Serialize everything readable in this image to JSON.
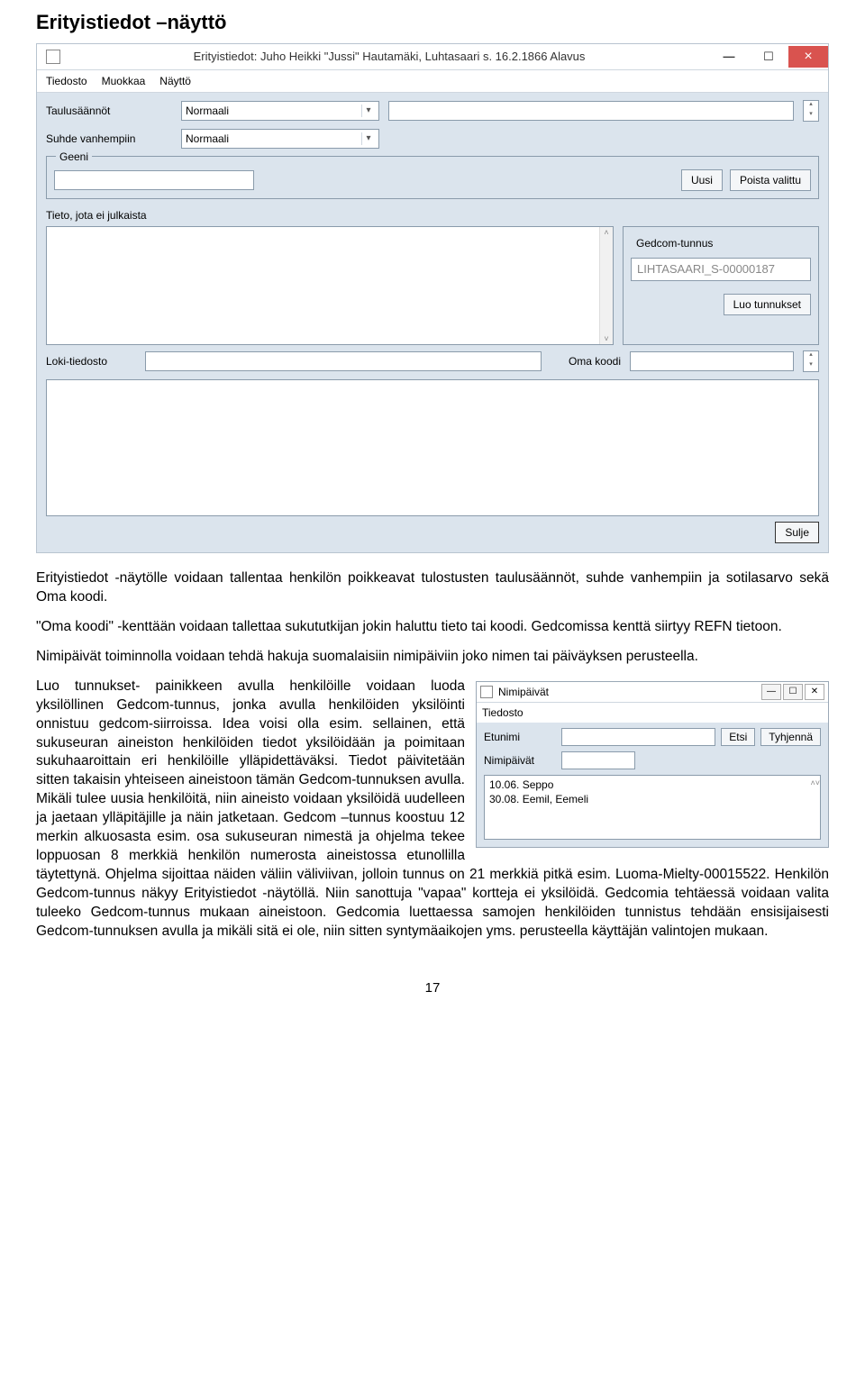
{
  "heading": "Erityistiedot –näyttö",
  "win1": {
    "title": "Erityistiedot: Juho Heikki \"Jussi\" Hautamäki, Luhtasaari  s. 16.2.1866 Alavus",
    "menu": {
      "file": "Tiedosto",
      "edit": "Muokkaa",
      "view": "Näyttö"
    },
    "row1_label": "Taulusäännöt",
    "row1_value": "Normaali",
    "row2_label": "Suhde vanhempiin",
    "row2_value": "Normaali",
    "geeni_legend": "Geeni",
    "btn_uusi": "Uusi",
    "btn_poista": "Poista valittu",
    "notpublic_label": "Tieto, jota ei julkaista",
    "gedcom_legend": "Gedcom-tunnus",
    "gedcom_value": "LIHTASAARI_S-00000187",
    "btn_luo": "Luo tunnukset",
    "loki_label": "Loki-tiedosto",
    "oma_label": "Oma koodi",
    "btn_sulje": "Sulje"
  },
  "para1": "Erityistiedot -näytölle voidaan tallentaa henkilön poikkeavat tulostusten taulusäännöt, suhde vanhempiin ja sotilasarvo sekä Oma koodi.",
  "para2": "\"Oma koodi\" -kenttään voidaan tallettaa sukututkijan jokin haluttu tieto tai koodi. Gedcomissa kenttä siirtyy REFN tietoon.",
  "para3": "Nimipäivät toiminnolla voidaan tehdä hakuja suomalaisiin nimipäiviin joko nimen tai päiväyksen perusteella.",
  "para4a": "Luo tunnukset- painikkeen avulla henkilöille voidaan luoda yksilöllinen Gedcom-tunnus, jonka avulla henkilöiden yksilöinti onnistuu gedcom-siirroissa. Idea voisi olla esim. sellainen, että sukuseuran aineiston henkilöiden tiedot yksilöidään ja poimitaan sukuhaaroittain eri henkilöille ylläpidettäväksi. Tie",
  "para4b": "dot päivitetään sitten takaisin yhteiseen aineistoon tämän Gedcom-tunnuksen avulla. Mikäli tulee uusia henkilöitä, niin aineisto voidaan yksilöidä uudelleen ja jaetaan ylläpitäjille ja näin jatketaan. Gedcom –tunnus koostuu 12 merkin alkuosasta esim. osa sukuseuran nimestä ja ohjelma tekee loppuosan 8 merkkiä henkilön numerosta aineistossa etunollilla täytettynä. Ohjelma sijoittaa näiden väliin väliviivan, jolloin tunnus on 21 merkkiä pitkä esim. Luoma-Mielty-00015522. Henkilön Gedcom-tunnus näkyy Erityistiedot -näytöllä. Niin sanottuja \"vapaa\" kortteja ei yksilöidä. Gedcomia tehtäessä voidaan valita tuleeko Gedcom-tunnus mukaan aineistoon. Gedcomia luettaessa samojen henkilöiden tunnistus tehdään ensisijaisesti Gedcom-tunnuksen avulla ja mikäli sitä ei ole, niin sitten syntymäaikojen yms. perusteella käyttäjän valintojen mukaan.",
  "win2": {
    "title": "Nimipäivät",
    "menu_file": "Tiedosto",
    "etunimi_label": "Etunimi",
    "btn_etsi": "Etsi",
    "btn_tyhjenna": "Tyhjennä",
    "nimipaivat_label": "Nimipäivät",
    "results": [
      "10.06. Seppo",
      "30.08. Eemil, Eemeli"
    ]
  },
  "pagenum": "17"
}
